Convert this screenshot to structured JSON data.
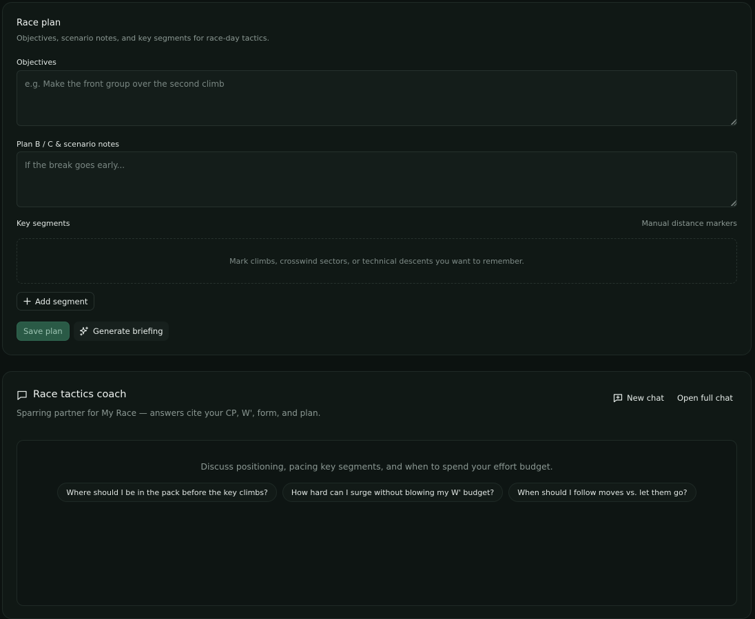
{
  "race_plan": {
    "title": "Race plan",
    "subtitle": "Objectives, scenario notes, and key segments for race-day tactics.",
    "objectives": {
      "label": "Objectives",
      "placeholder": "e.g. Make the front group over the second climb",
      "value": ""
    },
    "scenario": {
      "label": "Plan B / C & scenario notes",
      "placeholder": "If the break goes early...",
      "value": ""
    },
    "key_segments": {
      "label": "Key segments",
      "aside": "Manual distance markers",
      "empty_text": "Mark climbs, crosswind sectors, or technical descents you want to remember.",
      "add_label": "Add segment"
    },
    "actions": {
      "save_label": "Save plan",
      "generate_label": "Generate briefing"
    }
  },
  "coach": {
    "title": "Race tactics coach",
    "subtitle": "Sparring partner for My Race — answers cite your CP, W', form, and plan.",
    "new_chat_label": "New chat",
    "open_full_label": "Open full chat",
    "hint": "Discuss positioning, pacing key segments, and when to spend your effort budget.",
    "suggestions": [
      "Where should I be in the pack before the key climbs?",
      "How hard can I surge without blowing my W' budget?",
      "When should I follow moves vs. let them go?"
    ]
  },
  "colors": {
    "background": "#0c1210",
    "card": "#101815",
    "accent": "#2a5a46"
  }
}
